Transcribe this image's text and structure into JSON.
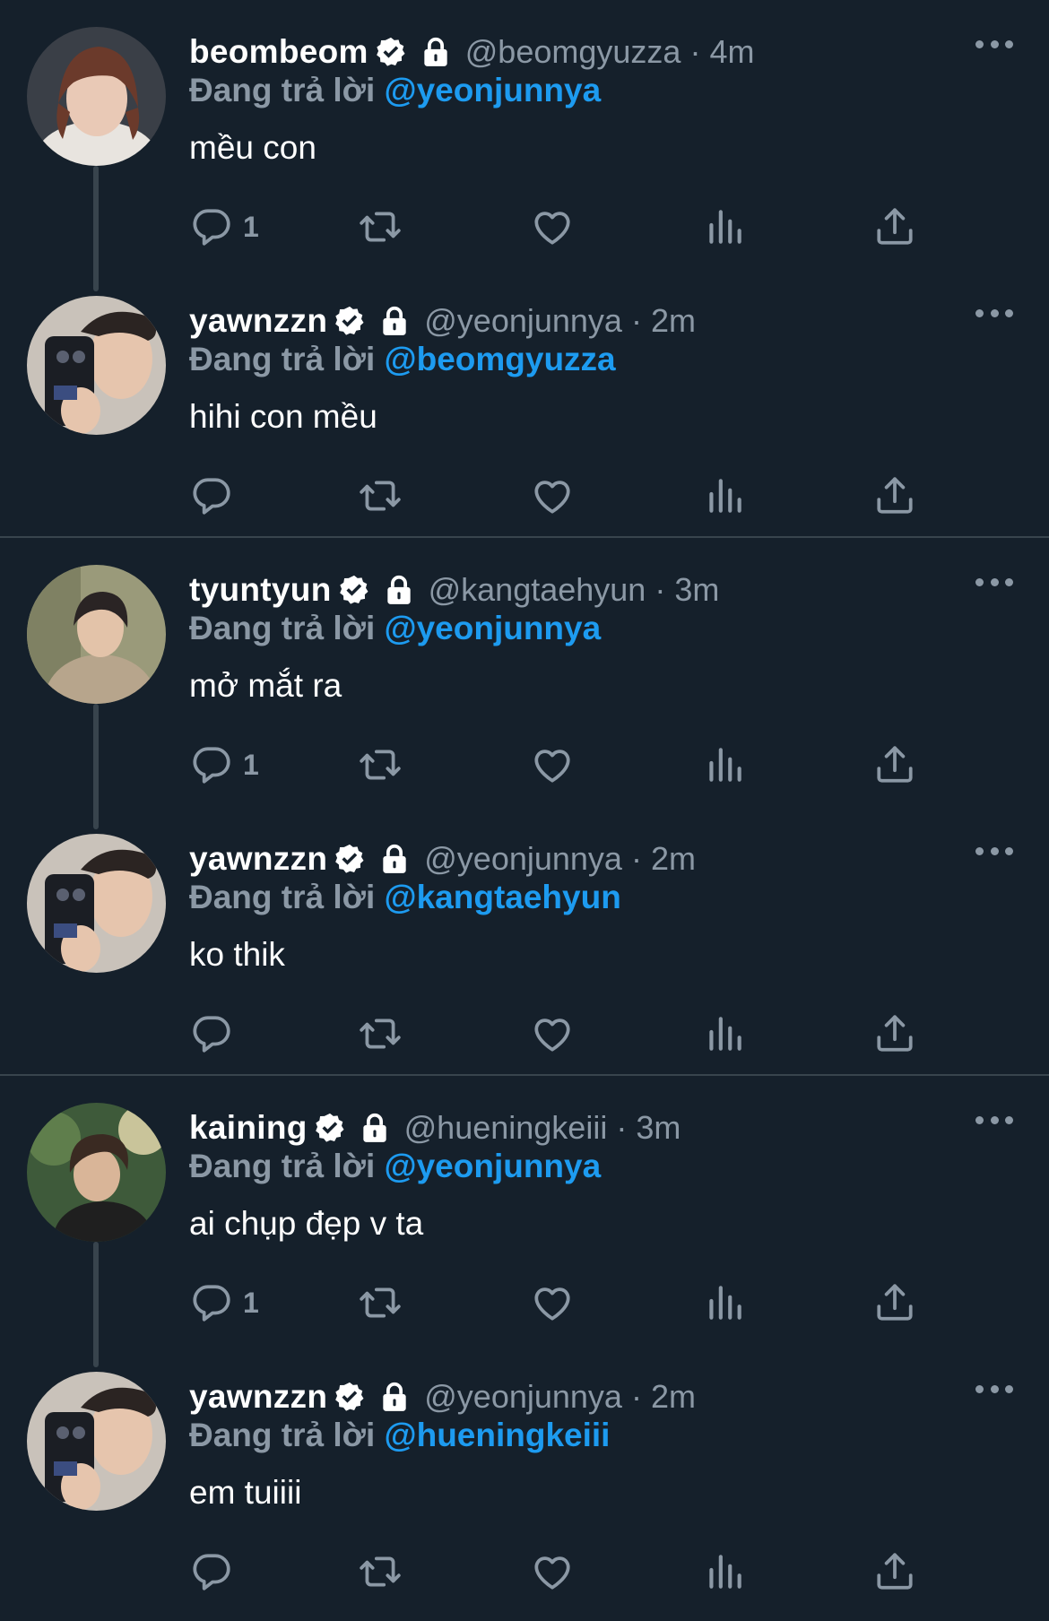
{
  "replying_label": "Đang trả lời",
  "colors": {
    "background": "#15202b",
    "accent": "#1d9bf0",
    "muted": "#8b98a5",
    "divider": "#38444d"
  },
  "icons": {
    "verified": "verified-badge-icon",
    "protected": "lock-icon",
    "more": "more-icon",
    "reply": "reply-icon",
    "retweet": "retweet-icon",
    "like": "like-icon",
    "views": "views-icon",
    "share": "share-icon"
  },
  "threads": [
    {
      "tweets": [
        {
          "name": "beombeom",
          "handle": "@beomgyuzza",
          "time": "4m",
          "reply_to": "@yeonjunnya",
          "text": "mều con",
          "reply_count": "1"
        },
        {
          "name": "yawnzzn",
          "handle": "@yeonjunnya",
          "time": "2m",
          "reply_to": "@beomgyuzza",
          "text": "hihi con mều",
          "reply_count": ""
        }
      ]
    },
    {
      "tweets": [
        {
          "name": "tyuntyun",
          "handle": "@kangtaehyun",
          "time": "3m",
          "reply_to": "@yeonjunnya",
          "text": "mở mắt ra",
          "reply_count": "1"
        },
        {
          "name": "yawnzzn",
          "handle": "@yeonjunnya",
          "time": "2m",
          "reply_to": "@kangtaehyun",
          "text": "ko thik",
          "reply_count": ""
        }
      ]
    },
    {
      "tweets": [
        {
          "name": "kaining",
          "handle": "@hueningkeiii",
          "time": "3m",
          "reply_to": "@yeonjunnya",
          "text": "ai chụp đẹp v ta",
          "reply_count": "1"
        },
        {
          "name": "yawnzzn",
          "handle": "@yeonjunnya",
          "time": "2m",
          "reply_to": "@hueningkeiii",
          "text": "em tuiiii",
          "reply_count": ""
        }
      ]
    }
  ]
}
